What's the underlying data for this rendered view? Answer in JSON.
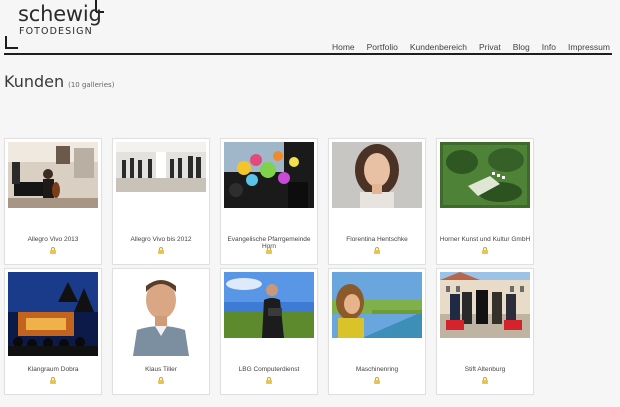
{
  "logo": {
    "line1": "schewig",
    "line2": "FOTODESIGN"
  },
  "nav": [
    "Home",
    "Portfolio",
    "Kundenbereich",
    "Privat",
    "Blog",
    "Info",
    "Impressum"
  ],
  "page": {
    "title": "Kunden",
    "count": "(10 galleries)"
  },
  "galleries": [
    {
      "name": "Allegro Vivo 2013",
      "locked": true,
      "thumb": "concert-piano-icon"
    },
    {
      "name": "Allegro Vivo bis 2012",
      "locked": true,
      "thumb": "ensemble-hall-icon"
    },
    {
      "name": "Evangelische Pfarrgemeinde Horn",
      "locked": true,
      "thumb": "balloons-icon"
    },
    {
      "name": "Florentina Hentschke",
      "locked": true,
      "thumb": "portrait-woman-icon"
    },
    {
      "name": "Horner Kunst und Kultur GmbH",
      "locked": true,
      "thumb": "aerial-park-icon"
    },
    {
      "name": "Klangraum Dobra",
      "locked": true,
      "thumb": "night-stage-icon"
    },
    {
      "name": "Klaus Tiller",
      "locked": true,
      "thumb": "portrait-man-icon"
    },
    {
      "name": "LBG Computerdienst",
      "locked": true,
      "thumb": "man-laptop-field-icon"
    },
    {
      "name": "Maschinenring",
      "locked": true,
      "thumb": "woman-canal-icon"
    },
    {
      "name": "Stift Altenburg",
      "locked": true,
      "thumb": "group-abbey-icon"
    }
  ]
}
